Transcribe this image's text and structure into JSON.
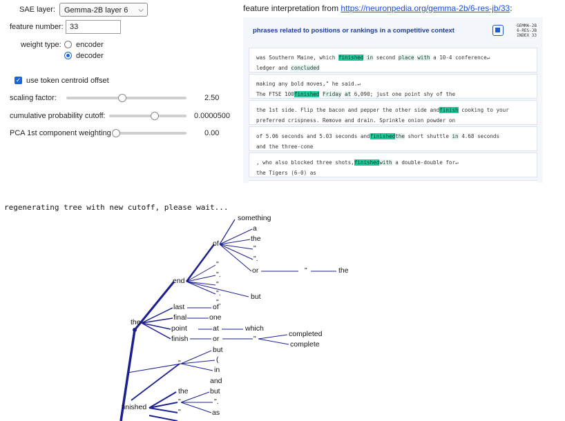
{
  "controls": {
    "sae_layer_label": "SAE layer:",
    "sae_layer_value": "Gemma-2B layer 6",
    "feature_number_label": "feature number:",
    "feature_number_value": "33",
    "weight_type_label": "weight type:",
    "weight_options": [
      "encoder",
      "decoder"
    ],
    "weight_selected": "decoder",
    "centroid_label": "use token centroid offset",
    "centroid_checked": true,
    "scaling_label": "scaling factor:",
    "scaling_value": "2.50",
    "cumulative_label": "cumulative probability cutoff:",
    "cumulative_value": "0.0000500",
    "pca_label": "PCA 1st component weighting",
    "pca_value": "0.00",
    "slider_levels": {
      "scaling": 0.46,
      "cumulative": 0.6,
      "pca": 0.0
    }
  },
  "interpretation": {
    "title_prefix": "feature interpretation from ",
    "link": "https://neuronpedia.org/gemma-2b/6-res-jb/33",
    "title_suffix": ":",
    "heading": "phrases related to positions or rankings in a competitive context",
    "badge_lines": [
      "GEMMA-2B",
      "6-RES-JB",
      "INDEX 33"
    ],
    "examples": [
      [
        "was Southern Maine, which",
        "finished",
        " in",
        "second",
        "place",
        "with",
        "a 10-4 conference↵",
        "ledger and",
        "concluded"
      ],
      [
        "making any bold moves,\" he said.↵",
        "The FTSE 100",
        "finished",
        "Friday",
        "at",
        "6,090; just one point shy of the"
      ],
      [
        "the 1st side. Flip the bacon and pepper the other side and",
        "finish",
        "cooking to your",
        "preferred crispness. Remove and drain. Sprinkle onion powder on"
      ],
      [
        "of 5.06 seconds and 5.03 seconds and",
        "finished",
        "the",
        "short shuttle",
        "in",
        "4.68 seconds",
        "and the three-cone"
      ],
      [
        ", who also blocked three shots,",
        "finished",
        "with",
        "a double-double for↵",
        "the Tigers (6-0) as"
      ]
    ]
  },
  "status": "regenerating tree with new cutoff, please wait...",
  "tree": {
    "words": [
      "something",
      "a",
      "the",
      "\"",
      "\".",
      "of",
      "\"",
      "\".",
      "or",
      "\"",
      "the",
      "end",
      "\"",
      "\".",
      "\",",
      "but",
      "last",
      "of",
      "final",
      "one",
      "point",
      "at",
      "which",
      "finish",
      "or",
      "\"",
      "completed",
      "complete",
      "but",
      "\"",
      "(",
      "in",
      "and",
      "the",
      "but",
      "\"",
      "\".",
      "finished",
      "\"",
      "as"
    ]
  }
}
